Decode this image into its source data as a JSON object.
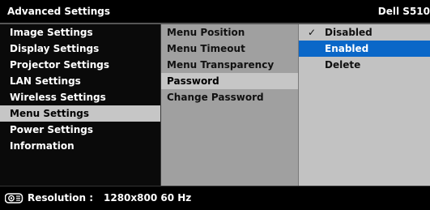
{
  "header": {
    "title": "Advanced Settings",
    "model": "Dell S510"
  },
  "menu": {
    "items": [
      {
        "label": "Image Settings"
      },
      {
        "label": "Display Settings"
      },
      {
        "label": "Projector Settings"
      },
      {
        "label": "LAN Settings"
      },
      {
        "label": "Wireless Settings"
      },
      {
        "label": "Menu Settings",
        "selected": true
      },
      {
        "label": "Power Settings"
      },
      {
        "label": "Information"
      }
    ]
  },
  "submenu": {
    "items": [
      {
        "label": "Menu Position"
      },
      {
        "label": "Menu Timeout"
      },
      {
        "label": "Menu Transparency"
      },
      {
        "label": "Password",
        "selected": true
      },
      {
        "label": "Change Password"
      }
    ]
  },
  "options": {
    "items": [
      {
        "label": "Disabled",
        "checked": true
      },
      {
        "label": "Enabled",
        "highlighted": true
      },
      {
        "label": "Delete"
      }
    ],
    "check_mark": "✓"
  },
  "footer": {
    "resolution_label": "Resolution :",
    "resolution_value": "1280x800 60 Hz",
    "icon": "projector-icon"
  },
  "colors": {
    "highlight_blue": "#0a67c8",
    "selected_gray": "#c6c6c6",
    "submenu_bg": "#a0a0a0",
    "options_bg": "#c2c2c2"
  }
}
